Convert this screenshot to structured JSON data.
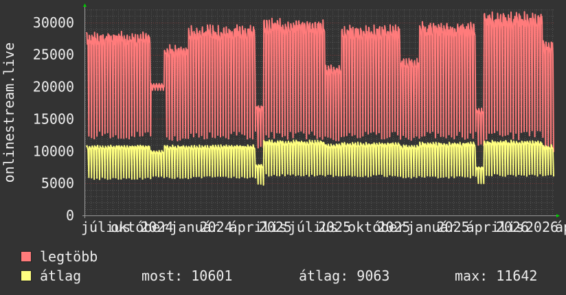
{
  "chart_data": {
    "type": "line",
    "ylabel": "onlinestream.live",
    "ylim": [
      0,
      32000
    ],
    "yticks": [
      0,
      5000,
      10000,
      15000,
      20000,
      25000,
      30000
    ],
    "xlabels": [
      "július",
      "október",
      "2024",
      "január",
      "2024",
      "április",
      "2025",
      "július",
      "2025",
      "október",
      "2025",
      "január",
      "2025",
      "április",
      "2026",
      "2026",
      "április"
    ],
    "grid": true,
    "colors": {
      "background": "#333333",
      "plot": "#333333",
      "grid": "#555555",
      "axis": "#999999",
      "max": "#ff7b7b",
      "avg": "#ffff80",
      "arrow": "#00cc00"
    },
    "series": [
      {
        "name": "legtöbb",
        "color": "#ff7b7b",
        "segments": [
          {
            "n": 24,
            "lo": 12500,
            "hi": 28000
          },
          {
            "n": 5,
            "lo": 20000,
            "hi": 20500
          },
          {
            "n": 9,
            "lo": 12000,
            "hi": 26000
          },
          {
            "n": 25,
            "lo": 12500,
            "hi": 29000
          },
          {
            "n": 3,
            "lo": 10500,
            "hi": 17000
          },
          {
            "n": 23,
            "lo": 12500,
            "hi": 30000
          },
          {
            "n": 6,
            "lo": 12000,
            "hi": 23000
          },
          {
            "n": 22,
            "lo": 12500,
            "hi": 29000
          },
          {
            "n": 7,
            "lo": 12000,
            "hi": 24000
          },
          {
            "n": 21,
            "lo": 12500,
            "hi": 29500
          },
          {
            "n": 3,
            "lo": 11000,
            "hi": 16500
          },
          {
            "n": 22,
            "lo": 12500,
            "hi": 31000
          },
          {
            "n": 4,
            "lo": 10000,
            "hi": 27000
          }
        ]
      },
      {
        "name": "átlag",
        "color": "#ffff80",
        "segments": [
          {
            "n": 24,
            "lo": 5800,
            "hi": 10800
          },
          {
            "n": 5,
            "lo": 6000,
            "hi": 10000
          },
          {
            "n": 9,
            "lo": 5900,
            "hi": 10800
          },
          {
            "n": 25,
            "lo": 6000,
            "hi": 10800
          },
          {
            "n": 3,
            "lo": 4800,
            "hi": 7800
          },
          {
            "n": 23,
            "lo": 6300,
            "hi": 11500
          },
          {
            "n": 6,
            "lo": 6200,
            "hi": 11000
          },
          {
            "n": 22,
            "lo": 6200,
            "hi": 11200
          },
          {
            "n": 7,
            "lo": 6000,
            "hi": 10800
          },
          {
            "n": 21,
            "lo": 6000,
            "hi": 11200
          },
          {
            "n": 3,
            "lo": 5000,
            "hi": 7500
          },
          {
            "n": 22,
            "lo": 6300,
            "hi": 11500
          },
          {
            "n": 4,
            "lo": 6200,
            "hi": 10800
          }
        ]
      }
    ]
  },
  "legend": {
    "max_label": "legtöbb",
    "avg_label": "átlag",
    "now": "most: 10601",
    "avg": "átlag: 9063",
    "max": "max: 11642"
  }
}
